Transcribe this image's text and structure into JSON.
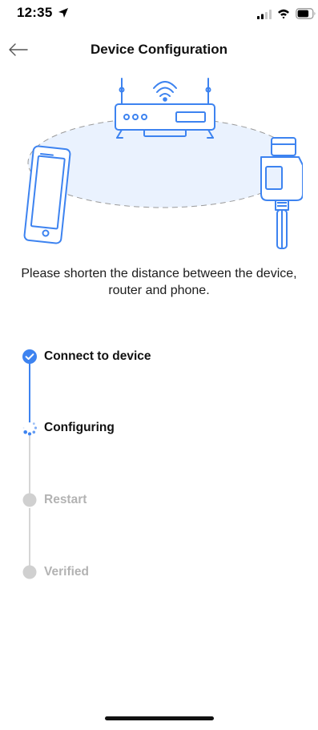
{
  "status_bar": {
    "time": "12:35",
    "icons": [
      "location-arrow-icon",
      "cellular-signal-icon",
      "wifi-icon",
      "battery-icon"
    ]
  },
  "nav": {
    "title": "Device Configuration",
    "back_icon": "back-arrow-icon"
  },
  "hint": "Please shorten the distance between the device, router and phone.",
  "steps": [
    {
      "label": "Connect to device",
      "state": "done"
    },
    {
      "label": "Configuring",
      "state": "in-progress"
    },
    {
      "label": "Restart",
      "state": "pending"
    },
    {
      "label": "Verified",
      "state": "pending"
    }
  ],
  "colors": {
    "accent": "#3d83f0",
    "pending": "#d0d0d0",
    "pending_text": "#b3b3b3",
    "illustration_fill": "#eaf2fe"
  }
}
